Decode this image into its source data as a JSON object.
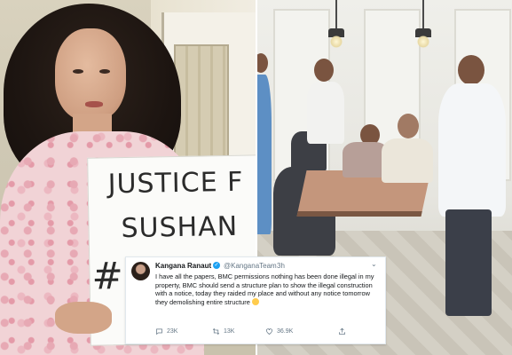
{
  "placard": {
    "line1": "JUSTICE F",
    "line2": "SUSHAN",
    "line3": "#C"
  },
  "tweet": {
    "name": "Kangana Ranaut",
    "handle": "@KanganaTeam",
    "separator": "·",
    "time": "3h",
    "body": "I have all the papers, BMC permissions nothing has been done illegal in my property, BMC should send a structure plan to show the illegal construction with a notice, today they raided my place and without any notice tomorrow they demolishing entire structure",
    "replies": "23K",
    "retweets": "13K",
    "likes": "36.9K",
    "icons": {
      "reply": "reply-icon",
      "retweet": "retweet-icon",
      "like": "heart-icon",
      "share": "share-icon",
      "verified": "verified-badge-icon",
      "more": "chevron-down-icon"
    }
  },
  "colors": {
    "verified": "#1da1f2",
    "meta_text": "#657786",
    "body_text": "#14171a"
  }
}
